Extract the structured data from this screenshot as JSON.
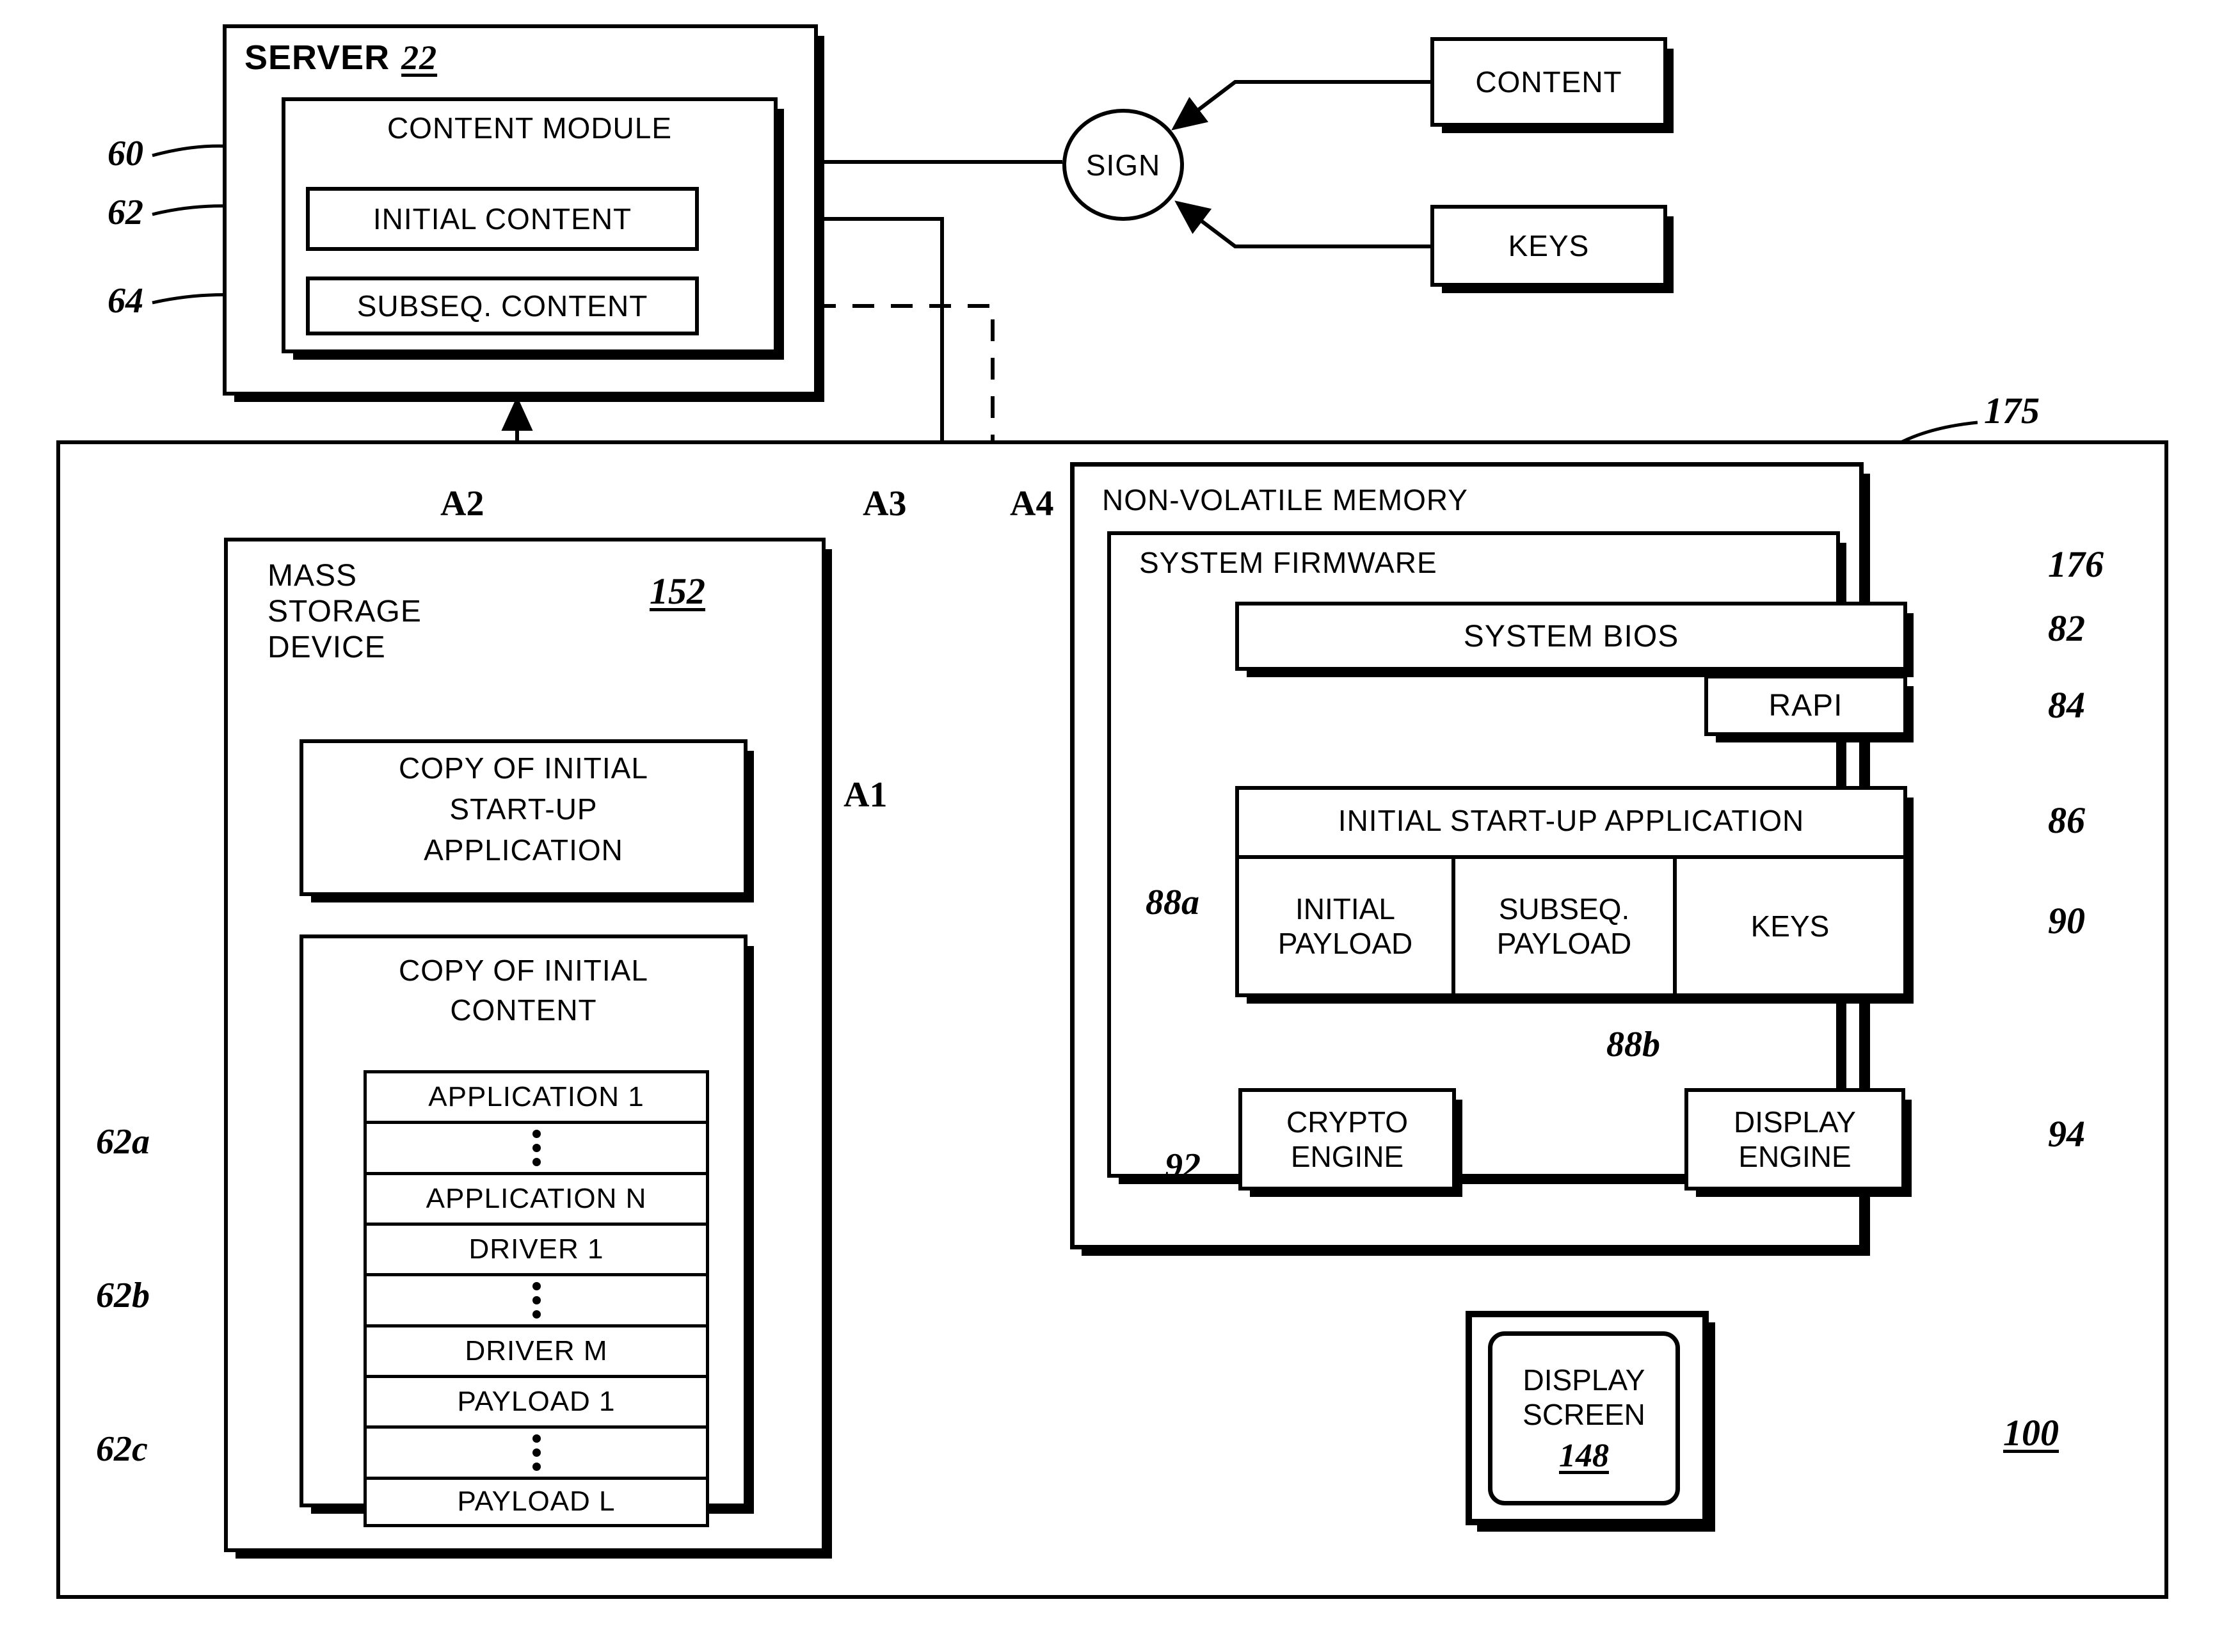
{
  "figure": {
    "system_ref": "100",
    "server": {
      "title": "SERVER",
      "title_ref": "22",
      "content_module": "CONTENT MODULE",
      "content_module_ref": "60",
      "initial_content": "INITIAL CONTENT",
      "initial_content_ref": "62",
      "subseq_content": "SUBSEQ. CONTENT",
      "subseq_content_ref": "64"
    },
    "signing": {
      "sign": "SIGN",
      "content": "CONTENT",
      "keys": "KEYS"
    },
    "mass_storage": {
      "title_line1": "MASS",
      "title_line2": "STORAGE",
      "title_line3": "DEVICE",
      "ref": "152",
      "copy_startup_line1": "COPY OF INITIAL",
      "copy_startup_line2": "START-UP",
      "copy_startup_line3": "APPLICATION",
      "copy_content_line1": "COPY OF INITIAL",
      "copy_content_line2": "CONTENT",
      "rows": [
        {
          "label": "APPLICATION  1",
          "type": "text"
        },
        {
          "label": "",
          "type": "vdots"
        },
        {
          "label": "APPLICATION  N",
          "type": "text"
        },
        {
          "label": "DRIVER  1",
          "type": "text"
        },
        {
          "label": "",
          "type": "vdots"
        },
        {
          "label": "DRIVER  M",
          "type": "text"
        },
        {
          "label": "PAYLOAD  1",
          "type": "text"
        },
        {
          "label": "",
          "type": "vdots"
        },
        {
          "label": "PAYLOAD  L",
          "type": "text"
        }
      ],
      "brace_refs": [
        "62a",
        "62b",
        "62c"
      ]
    },
    "nvm": {
      "title": "NON-VOLATILE MEMORY",
      "ref": "175",
      "firmware": {
        "title": "SYSTEM FIRMWARE",
        "ref": "176",
        "system_bios": "SYSTEM BIOS",
        "system_bios_ref": "82",
        "rapi": "RAPI",
        "rapi_ref": "84",
        "initial_startup_app": "INITIAL START-UP APPLICATION",
        "initial_startup_app_ref": "86",
        "initial_payload_line1": "INITIAL",
        "initial_payload_line2": "PAYLOAD",
        "initial_payload_ref": "88a",
        "subseq_payload_line1": "SUBSEQ.",
        "subseq_payload_line2": "PAYLOAD",
        "subseq_payload_ref": "88b",
        "keys": "KEYS",
        "keys_ref": "90",
        "crypto_engine_line1": "CRYPTO",
        "crypto_engine_line2": "ENGINE",
        "crypto_engine_ref": "92",
        "display_engine_line1": "DISPLAY",
        "display_engine_line2": "ENGINE",
        "display_engine_ref": "94"
      }
    },
    "display_screen": {
      "line1": "DISPLAY",
      "line2": "SCREEN",
      "ref": "148"
    },
    "flow_labels": [
      "A1",
      "A2",
      "A3",
      "A4"
    ]
  }
}
